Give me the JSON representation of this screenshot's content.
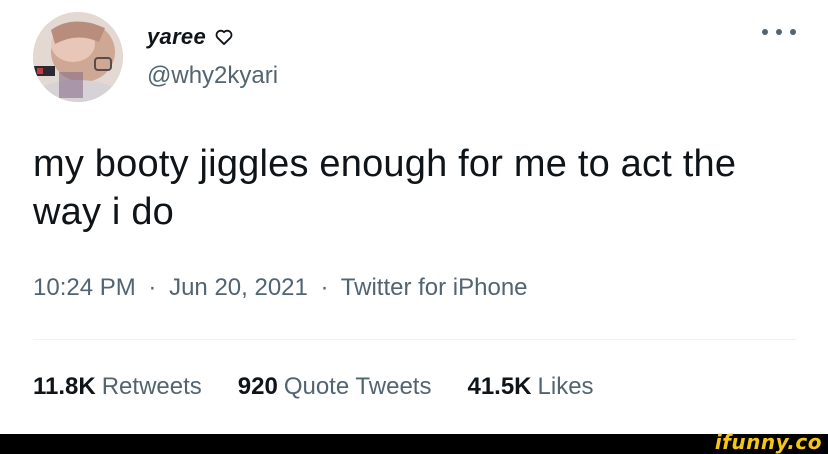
{
  "tweet": {
    "author": {
      "display_name": "yaree",
      "name_icon": "heart-outline-icon",
      "handle": "@why2kyari",
      "avatar": "profile-photo"
    },
    "more_icon": "more-options-icon",
    "text": "my booty jiggles enough for me to act the way i do",
    "meta": {
      "time": "10:24 PM",
      "separator": "·",
      "date": "Jun 20, 2021",
      "source": "Twitter for iPhone"
    },
    "stats": {
      "retweets_count": "11.8K",
      "retweets_label": "Retweets",
      "quotes_count": "920",
      "quotes_label": "Quote Tweets",
      "likes_count": "41.5K",
      "likes_label": "Likes"
    }
  },
  "watermark": "ifunny.co",
  "colors": {
    "text_primary": "#0f1419",
    "text_secondary": "#536471",
    "divider": "#eff3f4",
    "footer_bar": "#000000",
    "watermark": "#f5c518"
  }
}
